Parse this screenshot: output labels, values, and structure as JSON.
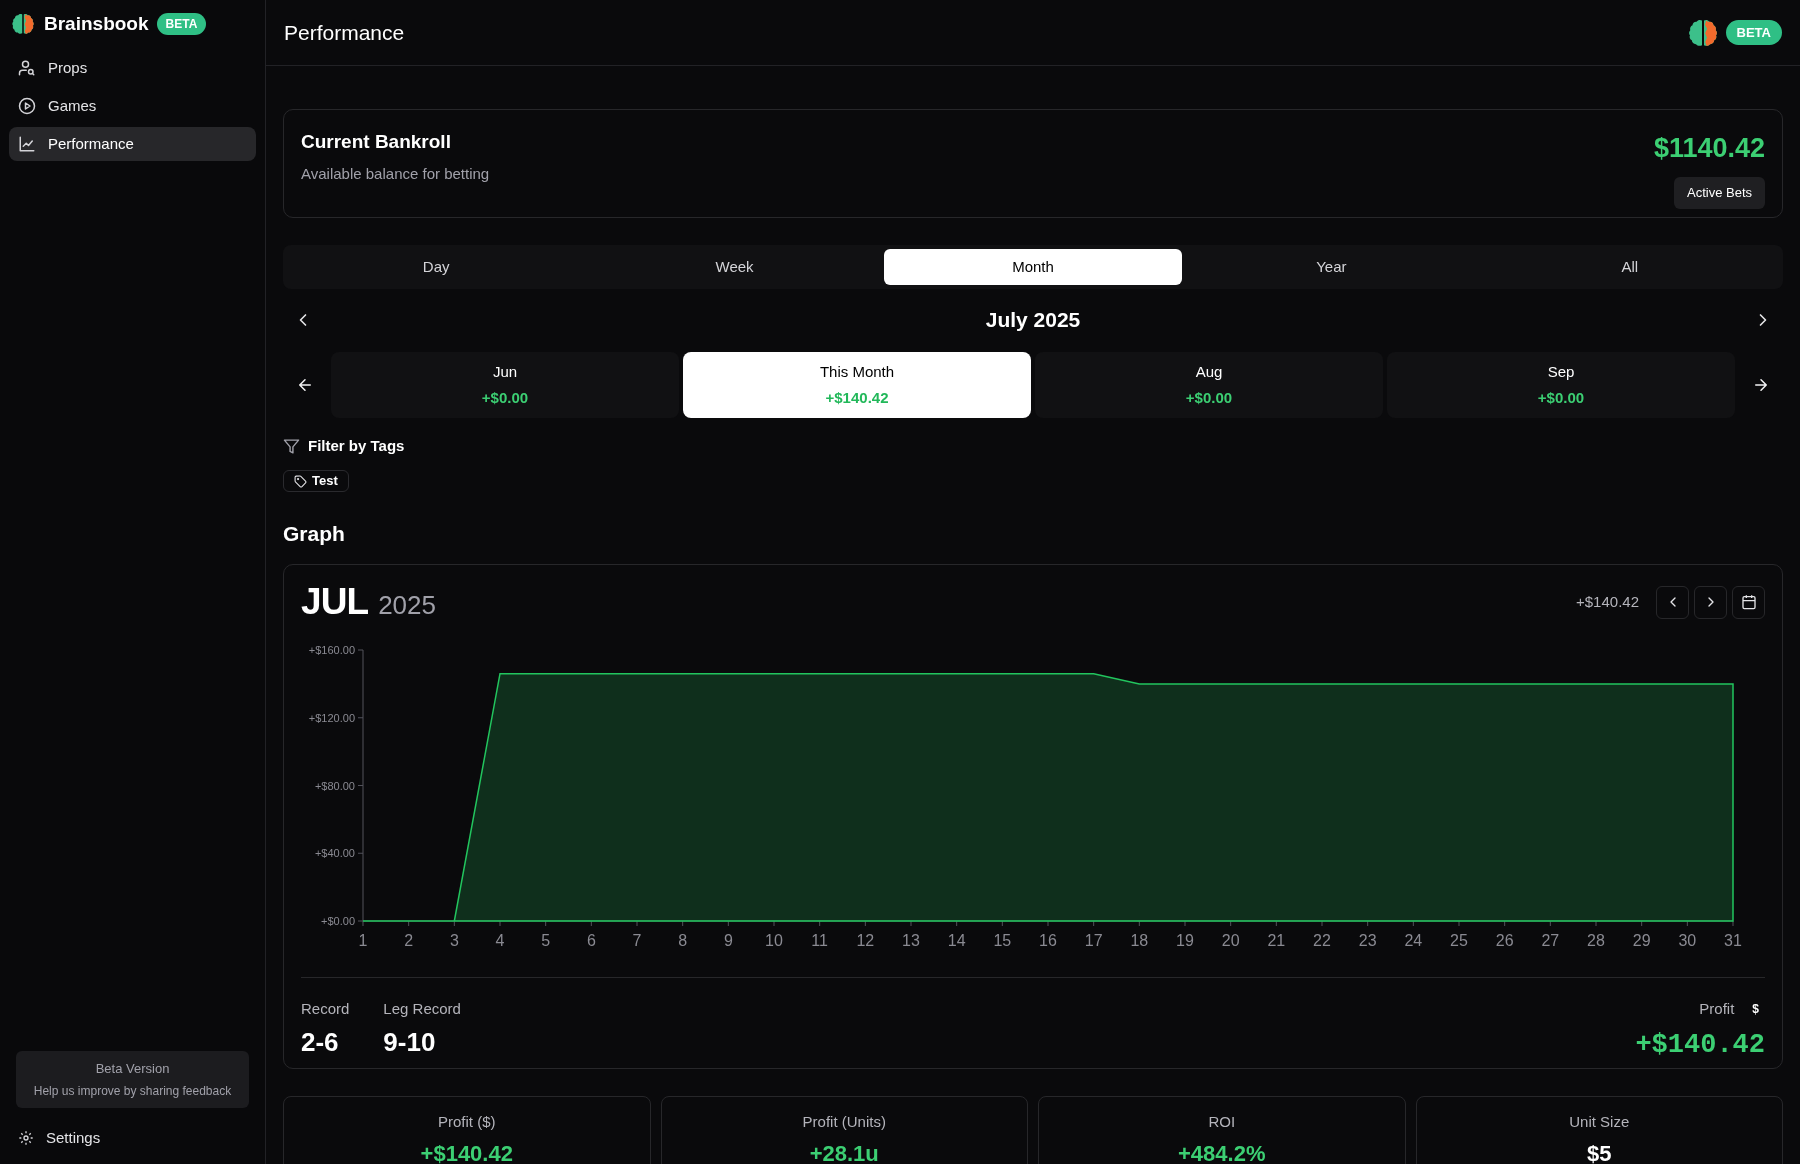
{
  "sidebar": {
    "brand": "Brainsbook",
    "badge": "BETA",
    "items": [
      {
        "label": "Props",
        "selected": false
      },
      {
        "label": "Games",
        "selected": false
      },
      {
        "label": "Performance",
        "selected": true
      }
    ],
    "beta_box": {
      "title": "Beta Version",
      "text": "Help us improve by sharing feedback"
    },
    "settings": "Settings"
  },
  "header": {
    "title": "Performance",
    "badge": "BETA"
  },
  "bankroll": {
    "title": "Current Bankroll",
    "subtitle": "Available balance for betting",
    "amount": "$1140.42",
    "button": "Active Bets"
  },
  "period_tabs": [
    {
      "label": "Day",
      "selected": false
    },
    {
      "label": "Week",
      "selected": false
    },
    {
      "label": "Month",
      "selected": true
    },
    {
      "label": "Year",
      "selected": false
    },
    {
      "label": "All",
      "selected": false
    }
  ],
  "period_title": "July 2025",
  "months": [
    {
      "label": "Jun",
      "value": "+$0.00",
      "selected": false
    },
    {
      "label": "This Month",
      "value": "+$140.42",
      "selected": true
    },
    {
      "label": "Aug",
      "value": "+$0.00",
      "selected": false
    },
    {
      "label": "Sep",
      "value": "+$0.00",
      "selected": false
    }
  ],
  "filter": {
    "title": "Filter by Tags",
    "tags": [
      "Test"
    ]
  },
  "graph": {
    "heading": "Graph",
    "month": "JUL",
    "year": "2025",
    "total": "+$140.42",
    "chart_data": {
      "type": "area",
      "x": [
        1,
        2,
        3,
        4,
        5,
        6,
        7,
        8,
        9,
        10,
        11,
        12,
        13,
        14,
        15,
        16,
        17,
        18,
        19,
        20,
        21,
        22,
        23,
        24,
        25,
        26,
        27,
        28,
        29,
        30,
        31
      ],
      "series": [
        {
          "color": "#22c55e",
          "values": [
            0,
            0,
            0,
            146,
            146,
            146,
            146,
            146,
            146,
            146,
            146,
            146,
            146,
            146,
            146,
            146,
            146,
            140,
            140,
            140,
            140,
            140,
            140,
            140,
            140,
            140,
            140,
            140,
            140,
            140,
            140
          ]
        }
      ],
      "xlim": [
        1,
        31
      ],
      "ylim": [
        0,
        160
      ],
      "yticks": [
        {
          "value": 0,
          "label": "+$0.00"
        },
        {
          "value": 40,
          "label": "+$40.00"
        },
        {
          "value": 80,
          "label": "+$80.00"
        },
        {
          "value": 120,
          "label": "+$120.00"
        },
        {
          "value": 160,
          "label": "+$160.00"
        }
      ],
      "xticks": [
        1,
        2,
        3,
        4,
        5,
        6,
        7,
        8,
        9,
        10,
        11,
        12,
        13,
        14,
        15,
        16,
        17,
        18,
        19,
        20,
        21,
        22,
        23,
        24,
        25,
        26,
        27,
        28,
        29,
        30,
        31
      ]
    },
    "stats": [
      {
        "label": "Record",
        "value": "2-6"
      },
      {
        "label": "Leg Record",
        "value": "9-10"
      }
    ],
    "profit_label": "Profit",
    "profit_unit": "$",
    "profit_value": "+$140.42"
  },
  "summary_cards": [
    {
      "label": "Profit ($)",
      "value": "+$140.42",
      "positive": true
    },
    {
      "label": "Profit (Units)",
      "value": "+28.1u",
      "positive": true
    },
    {
      "label": "ROI",
      "value": "+484.2%",
      "positive": true
    },
    {
      "label": "Unit Size",
      "value": "$5",
      "positive": false
    }
  ]
}
